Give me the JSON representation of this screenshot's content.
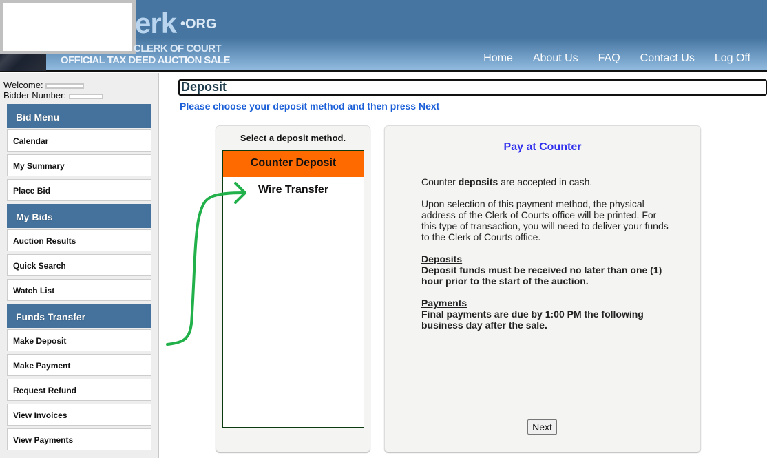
{
  "header": {
    "logo_partial": "erk",
    "logo_org": "•ORG",
    "logo_tagline": "CLERK OF COURT",
    "logo_subtitle": "OFFICIAL TAX DEED AUCTION SALE",
    "nav": [
      "Home",
      "About Us",
      "FAQ",
      "Contact Us",
      "Log Off"
    ]
  },
  "sidebar": {
    "welcome_label": "Welcome:",
    "bidder_label": "Bidder Number:",
    "sections": [
      {
        "title": "Bid Menu",
        "items": [
          "Calendar",
          "My Summary",
          "Place Bid"
        ]
      },
      {
        "title": "My Bids",
        "items": [
          "Auction Results",
          "Quick Search",
          "Watch List"
        ]
      },
      {
        "title": "Funds Transfer",
        "items": [
          "Make Deposit",
          "Make Payment",
          "Request Refund",
          "View Invoices",
          "View Payments"
        ]
      }
    ]
  },
  "main": {
    "title": "Deposit",
    "instructions": "Please choose your deposit method and then press Next",
    "method_panel": {
      "title": "Select a deposit method.",
      "options": [
        {
          "label": "Counter Deposit",
          "selected": true
        },
        {
          "label": "Wire Transfer",
          "selected": false
        }
      ]
    },
    "detail": {
      "title": "Pay at Counter",
      "line1_pre": "Counter ",
      "line1_bold": "deposits",
      "line1_post": " are accepted in cash.",
      "para2": "Upon selection of this payment method, the physical address of the Clerk of Courts office will be printed. For this type of transaction, you will need to deliver your funds to the Clerk of Courts office.",
      "deposits_heading": "Deposits",
      "deposits_text": "Deposit funds must be received no later than one (1) hour prior to the start of the auction.",
      "payments_heading": "Payments",
      "payments_text": "Final payments are due by 1:00 PM the following business day after the sale."
    },
    "next_label": "Next"
  },
  "colors": {
    "header_blue": "#4575a0",
    "menu_header": "#44729c",
    "selected_option": "#ff6a00",
    "instruction_blue": "#1b5fd8",
    "detail_title": "#3333ee",
    "annotation_arrow": "#22b04b"
  }
}
